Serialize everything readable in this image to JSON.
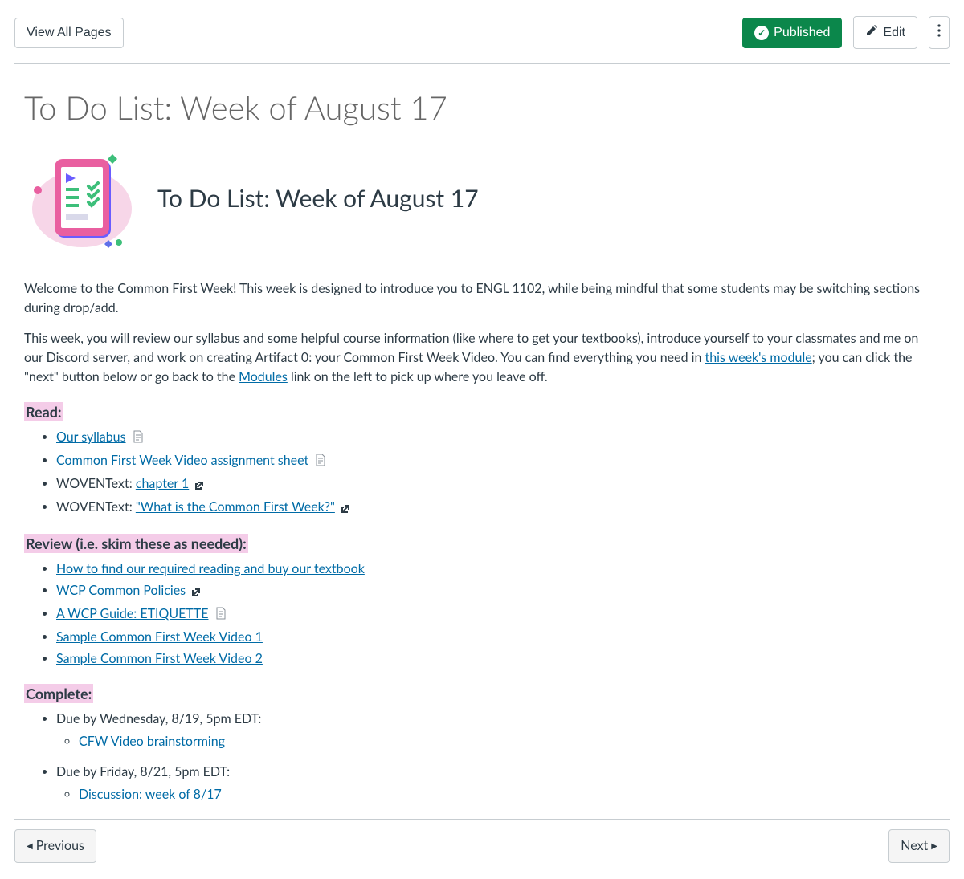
{
  "toolbar": {
    "view_all": "View All Pages",
    "published": "Published",
    "edit": "Edit"
  },
  "page_title": "To Do List: Week of August 17",
  "hero_title": "To Do List: Week of August 17",
  "intro_p1": "Welcome to the Common First Week! This week is designed to introduce you to ENGL 1102, while being mindful that some students may be switching sections during drop/add.",
  "intro_p2_a": "This week, you will review our syllabus and some helpful course information (like where to get your textbooks), introduce yourself to your classmates and me on our Discord server, and work on creating Artifact 0: your Common First Week Video. You can find everything you need in ",
  "intro_p2_link1": "this week's module",
  "intro_p2_b": "; you can click the \"next\" button below or go back to the ",
  "intro_p2_link2": "Modules",
  "intro_p2_c": " link on the left to pick up where you leave off.",
  "sections": {
    "read": {
      "heading": "Read:",
      "items": [
        {
          "text": "Our syllabus",
          "link": true,
          "doc_icon": true
        },
        {
          "text": "Common First Week Video assignment sheet",
          "link": true,
          "doc_icon": true
        },
        {
          "prefix": "WOVENText: ",
          "text": "chapter 1",
          "link": true,
          "ext_icon": true
        },
        {
          "prefix": "WOVENText: ",
          "text": "\"What is the Common First Week?\"",
          "link": true,
          "ext_icon": true
        }
      ]
    },
    "review": {
      "heading": "Review (i.e. skim these as needed):",
      "items": [
        {
          "text": "How to find our required reading and buy our textbook",
          "link": true
        },
        {
          "text": "WCP Common Policies",
          "link": true,
          "ext_icon": true
        },
        {
          "text": "A WCP Guide: ETIQUETTE",
          "link": true,
          "doc_icon": true
        },
        {
          "text": "Sample Common First Week Video 1",
          "link": true
        },
        {
          "text": "Sample Common First Week Video 2",
          "link": true
        }
      ]
    },
    "complete": {
      "heading": "Complete:",
      "items": [
        {
          "text": "Due by Wednesday, 8/19, 5pm EDT:",
          "children": [
            {
              "text": "CFW Video brainstorming",
              "link": true
            }
          ]
        },
        {
          "text": "Due by Friday, 8/21, 5pm EDT:",
          "children": [
            {
              "text": "Discussion: week of 8/17",
              "link": true
            }
          ]
        }
      ]
    }
  },
  "nav": {
    "previous": "Previous",
    "next": "Next"
  }
}
